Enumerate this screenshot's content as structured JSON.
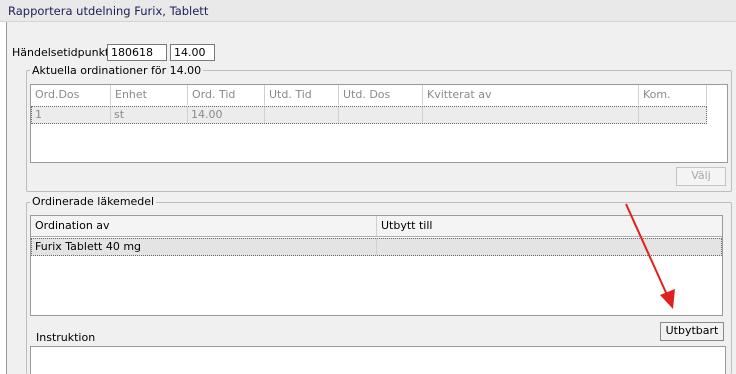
{
  "window": {
    "title": "Rapportera utdelning Furix, Tablett"
  },
  "event": {
    "label": "Händelsetidpunkt",
    "date": "180618",
    "time": "14.00"
  },
  "current_orders": {
    "legend": "Aktuella ordinationer för 14.00",
    "columns": [
      "Ord.Dos",
      "Enhet",
      "Ord. Tid",
      "Utd. Tid",
      "Utd. Dos",
      "Kvitterat av",
      "Kom."
    ],
    "rows": [
      [
        "1",
        "st",
        "14.00",
        "",
        "",
        "",
        ""
      ]
    ],
    "select_button": "Välj"
  },
  "ordered_drugs": {
    "legend": "Ordinerade läkemedel",
    "columns": [
      "Ordination av",
      "Utbytt till"
    ],
    "rows": [
      [
        "Furix Tablett 40 mg",
        ""
      ]
    ]
  },
  "instruction": {
    "label": "Instruktion"
  },
  "replace_button": "Utbytbart",
  "annotation": {
    "arrow_color": "#e0201c"
  }
}
